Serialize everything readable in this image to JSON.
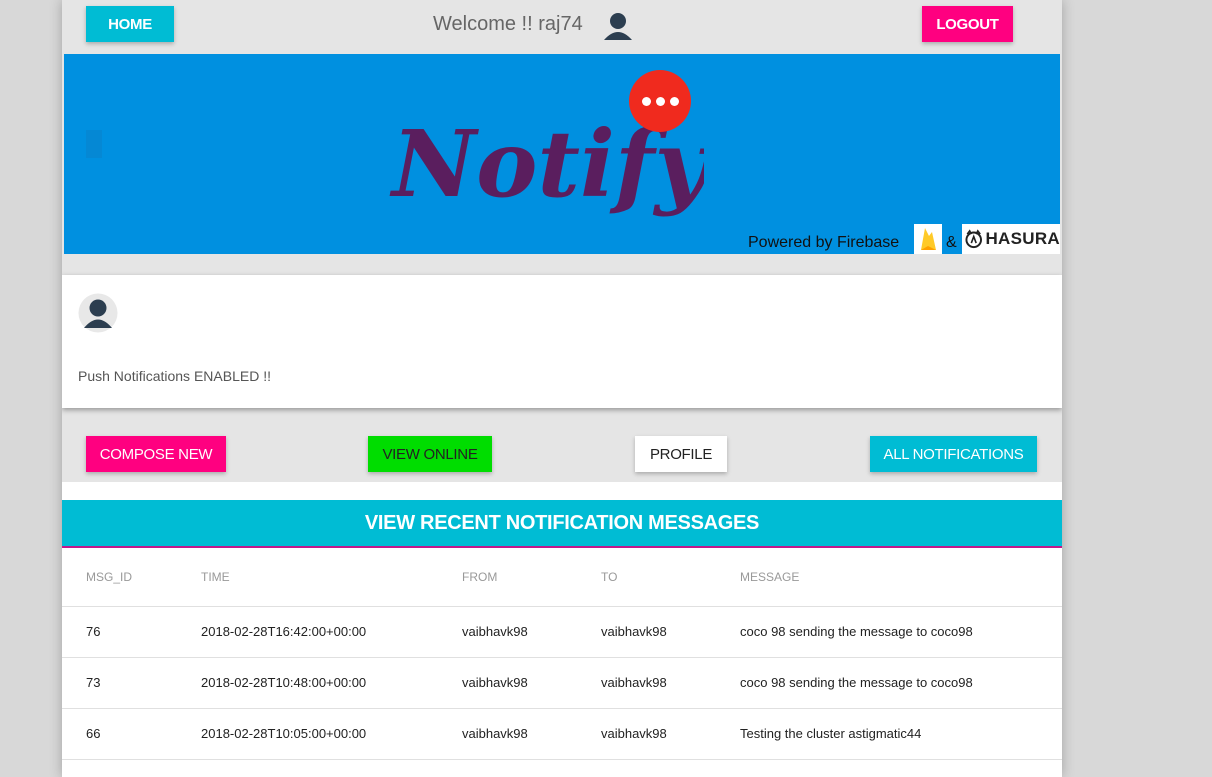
{
  "header": {
    "home_label": "HOME",
    "welcome_text": "Welcome !! raj74",
    "logout_label": "LOGOUT"
  },
  "banner": {
    "logo_text": "Notify",
    "powered_by": "Powered by Firebase",
    "amp": "&",
    "hasura": "HASURA"
  },
  "profile": {
    "push_status": "Push Notifications ENABLED !!"
  },
  "actions": {
    "compose": "COMPOSE NEW",
    "view_online": "VIEW ONLINE",
    "profile": "PROFILE",
    "all_notifications": "ALL NOTIFICATIONS"
  },
  "messages": {
    "title": "VIEW RECENT NOTIFICATION MESSAGES",
    "columns": [
      "MSG_ID",
      "TIME",
      "FROM",
      "TO",
      "MESSAGE"
    ],
    "rows": [
      {
        "id": "76",
        "time": "2018-02-28T16:42:00+00:00",
        "from": "vaibhavk98",
        "to": "vaibhavk98",
        "message": "coco 98 sending the message to coco98"
      },
      {
        "id": "73",
        "time": "2018-02-28T10:48:00+00:00",
        "from": "vaibhavk98",
        "to": "vaibhavk98",
        "message": "coco 98 sending the message to coco98"
      },
      {
        "id": "66",
        "time": "2018-02-28T10:05:00+00:00",
        "from": "vaibhavk98",
        "to": "vaibhavk98",
        "message": "Testing the cluster astigmatic44"
      }
    ]
  },
  "colors": {
    "cyan": "#00bcd4",
    "pink": "#ff0080",
    "green": "#00dd00",
    "banner_blue": "#0090e0",
    "logo_purple": "#5a1e5e",
    "badge_red": "#f02a1e"
  },
  "icons": {
    "user": "user-avatar-icon",
    "dots": "more-dots-icon",
    "firebase": "firebase-flame-icon",
    "hasura": "hasura-logo-icon"
  }
}
